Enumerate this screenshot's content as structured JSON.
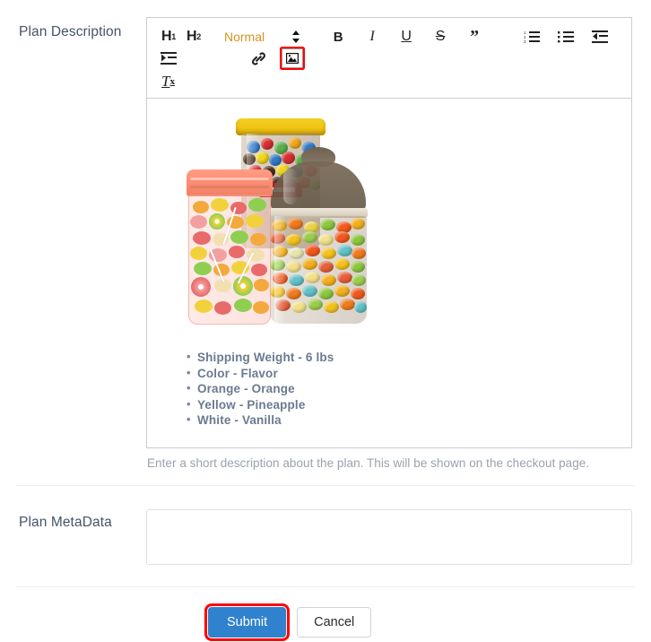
{
  "form": {
    "description_row": {
      "label": "Plan Description",
      "help_text": "Enter a short description about the plan. This will be shown on the checkout page."
    },
    "metadata_row": {
      "label": "Plan MetaData",
      "value": "",
      "placeholder": ""
    }
  },
  "editor": {
    "toolbar": {
      "heading1": "H",
      "heading1_sub": "1",
      "heading2": "H",
      "heading2_sub": "2",
      "format_picker_value": "Normal",
      "format_picker_color": "#d6941a",
      "bold": "B",
      "italic": "I",
      "underline": "U",
      "strikethrough": "S",
      "blockquote": "”",
      "ordered_list": "ordered-list-icon",
      "bullet_list": "bullet-list-icon",
      "outdent": "outdent-icon",
      "indent": "indent-icon",
      "link": "link-icon",
      "image": "image-icon",
      "clear_format": "T",
      "clear_format_sub": "x",
      "highlighted_button": "image-icon",
      "highlight_color": "#ff0000"
    },
    "content": {
      "image_alt": "three jars filled with assorted candy, jelly beans and chocolate candies",
      "bullets": [
        "Shipping Weight - 6 lbs",
        "Color - Flavor",
        "Orange - Orange",
        "Yellow - Pineapple",
        "White - Vanilla"
      ]
    }
  },
  "actions": {
    "submit_label": "Submit",
    "cancel_label": "Cancel",
    "submit_color": "#3182ce",
    "submit_highlight_color": "#ff0000"
  }
}
